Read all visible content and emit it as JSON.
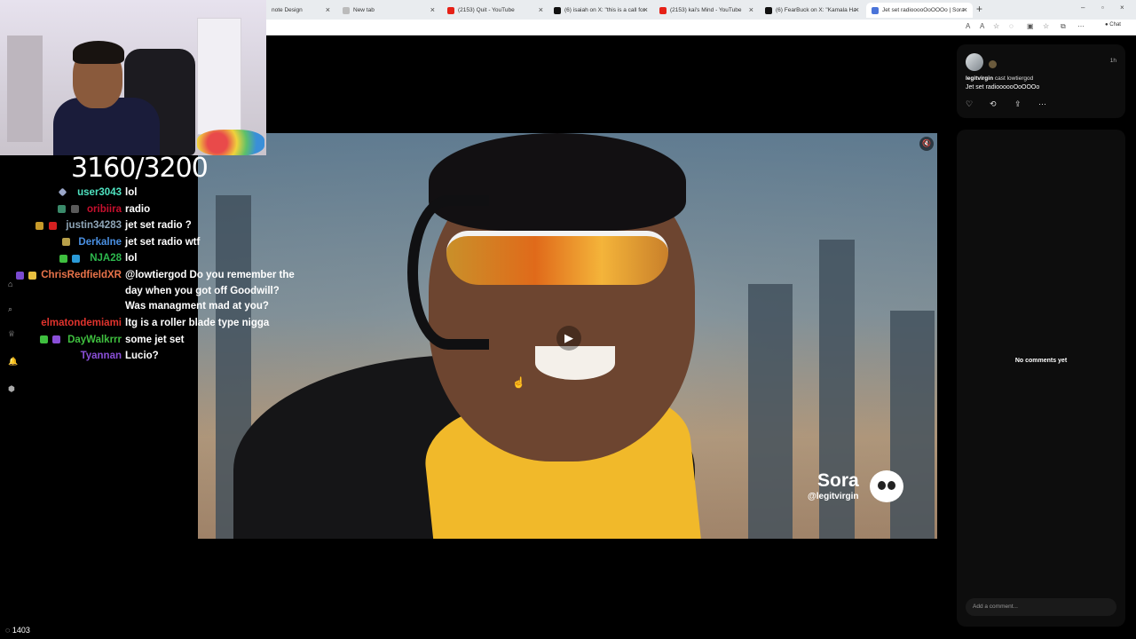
{
  "browser": {
    "tabs": [
      {
        "label": "note Design",
        "color": "#888888"
      },
      {
        "label": "New tab",
        "color": "#888888"
      },
      {
        "label": "(2153) Quit - YouTube",
        "color": "#e62117"
      },
      {
        "label": "(6) isaiah on X: \"this is a call for h...",
        "color": "#111111"
      },
      {
        "label": "(2153) kai's Mind - YouTube",
        "color": "#e62117"
      },
      {
        "label": "(6) FearBuck on X: \"Kamala Harris...",
        "color": "#111111"
      },
      {
        "label": "Jet set radiooooOoOOOo | Sora",
        "color": "#4a74d9"
      }
    ],
    "new_tab_symbol": "+",
    "chat_label": "Chat"
  },
  "stream": {
    "counter": "3160/3200",
    "viewer_count": "1403"
  },
  "chat": {
    "messages": [
      {
        "user": "user3043",
        "color": "#4fe3c1",
        "text": "lol"
      },
      {
        "user": "oribiira",
        "color": "#c8102e",
        "text": "radio"
      },
      {
        "user": "justin34283",
        "color": "#8fa6b8",
        "text": "jet set radio ?"
      },
      {
        "user": "Derkalne",
        "color": "#4a90e2",
        "text": "jet set radio wtf"
      },
      {
        "user": "NJA28",
        "color": "#2db84d",
        "text": "lol"
      },
      {
        "user": "ChrisRedfieldXR",
        "color": "#e8734a",
        "text": "@lowtiergod Do you remember the day when you got off Goodwill? Was managment mad at you?"
      },
      {
        "user": "elmatondemiami",
        "color": "#e0332d",
        "text": "ltg is a roller blade type nigga"
      },
      {
        "user": "DayWalkrrr",
        "color": "#3fbf3f",
        "text": "some jet set"
      },
      {
        "user": "Tyannan",
        "color": "#8a4fd8",
        "text": "Lucio?"
      }
    ]
  },
  "video": {
    "watermark_title": "Sora",
    "watermark_handle": "@legitvirgin"
  },
  "post": {
    "time": "1h",
    "username": "legitvirgin",
    "cast_text": "cast lowtiergod",
    "caption": "Jet set radioooooOoOOOo"
  },
  "comments": {
    "empty_text": "No comments yet",
    "input_placeholder": "Add a comment..."
  }
}
